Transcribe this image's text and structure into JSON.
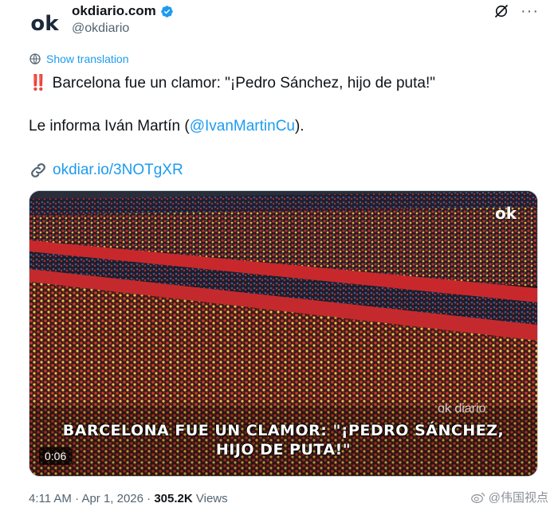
{
  "author": {
    "avatar_text": "ok",
    "display_name": "okdiario.com",
    "handle": "@okdiario"
  },
  "header": {
    "grok_icon": "grok-slash-icon",
    "more_label": "···"
  },
  "translation": {
    "label": "Show translation"
  },
  "tweet": {
    "alarm": "‼️",
    "line1_text": "Barcelona fue un clamor: \"¡Pedro Sánchez, hijo de puta!\"",
    "line2_prefix": "Le informa Iván Martín (",
    "mention": "@IvanMartinCu",
    "line2_suffix": ").",
    "link": "okdiar.io/3NOTgXR"
  },
  "media": {
    "watermark": "ok",
    "brand_watermark": "ok diario",
    "caption_line1": "BARCELONA FUE UN CLAMOR: \"¡PEDRO SÁNCHEZ,",
    "caption_line2": "HIJO DE PUTA!\"",
    "duration": "0:06"
  },
  "meta": {
    "time": "4:11 AM",
    "dot1": " · ",
    "date": "Apr 1, 2026",
    "dot2": " · ",
    "views_count": "305.2K",
    "views_label": " Views"
  },
  "source_watermark": "@伟国视点",
  "colors": {
    "accent": "#1d9bf0",
    "text": "#0f1419",
    "muted": "#536471",
    "crowd_red": "#b3262c",
    "crowd_yellow": "#e7b93a"
  }
}
